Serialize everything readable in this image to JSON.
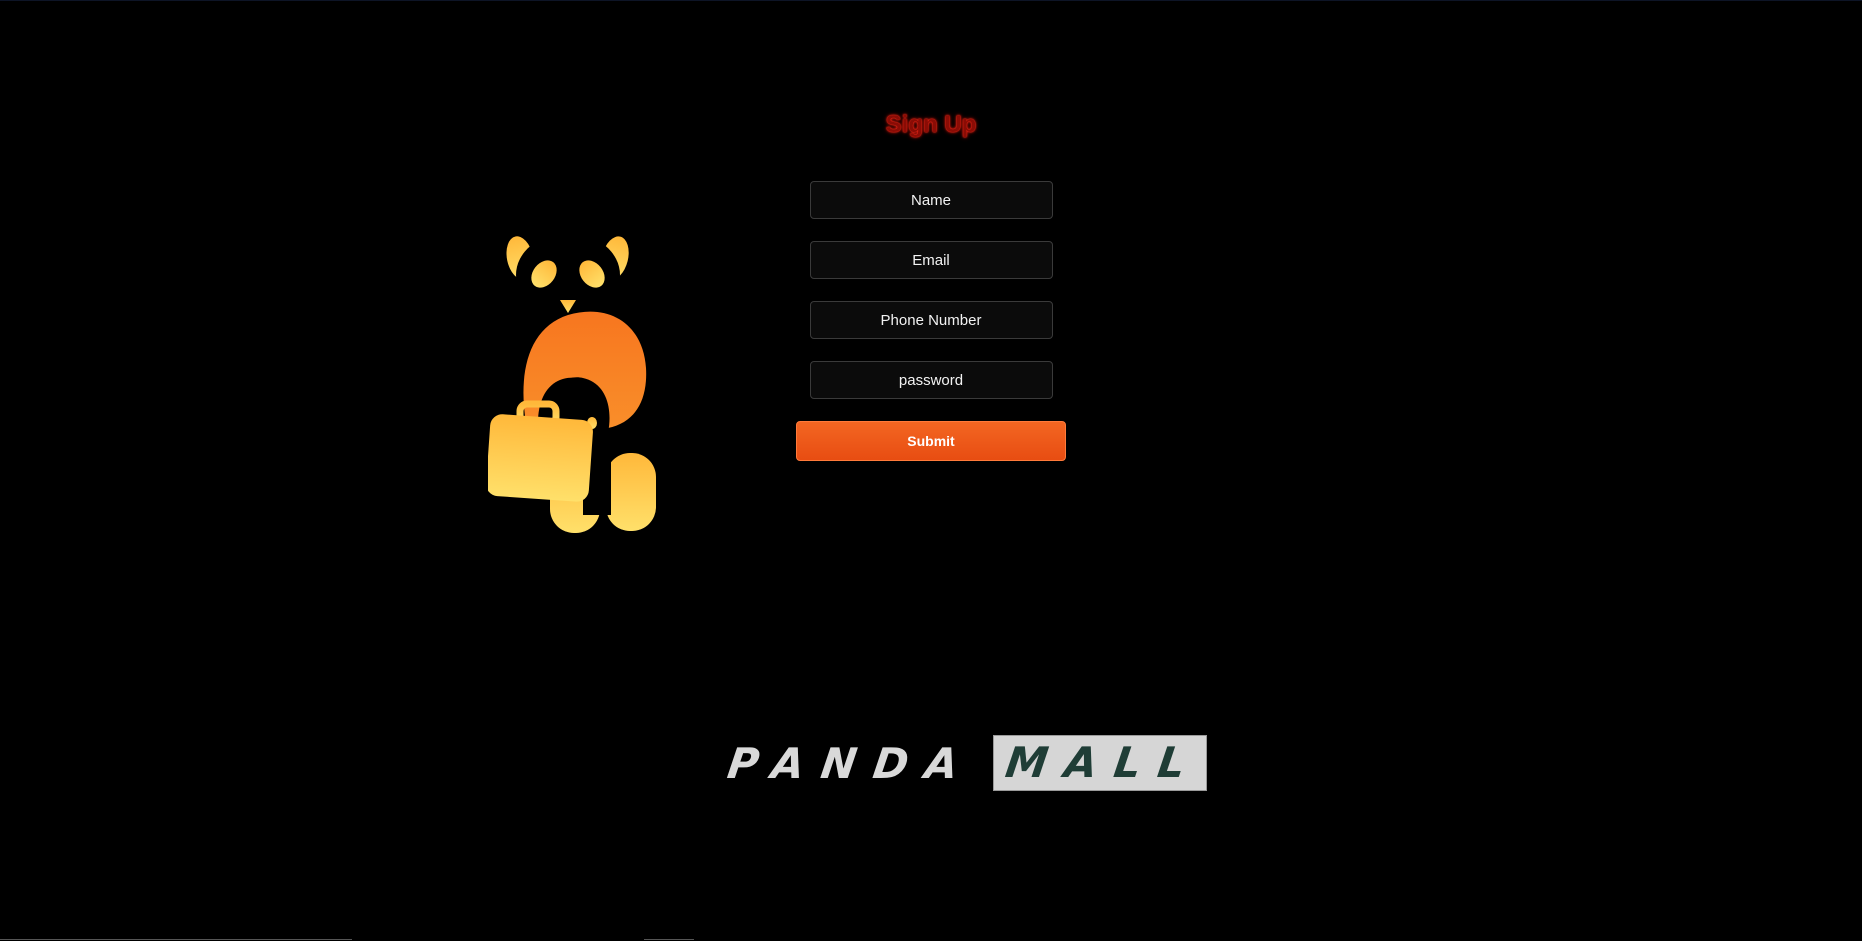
{
  "signup": {
    "title": "Sign Up",
    "fields": {
      "name_placeholder": "Name",
      "email_placeholder": "Email",
      "phone_placeholder": "Phone Number",
      "password_placeholder": "password"
    },
    "submit_label": "Submit"
  },
  "brand": {
    "word1": "PANDA",
    "word2": "MALL"
  },
  "mascot": {
    "icon": "panda-with-briefcase-icon"
  },
  "colors": {
    "background": "#000000",
    "title": "#8a0c05",
    "title_glow": "#ff2a1a",
    "accent_orange": "#f36622",
    "mascot_light": "#ffd75e",
    "mascot_dark": "#f47a21"
  }
}
